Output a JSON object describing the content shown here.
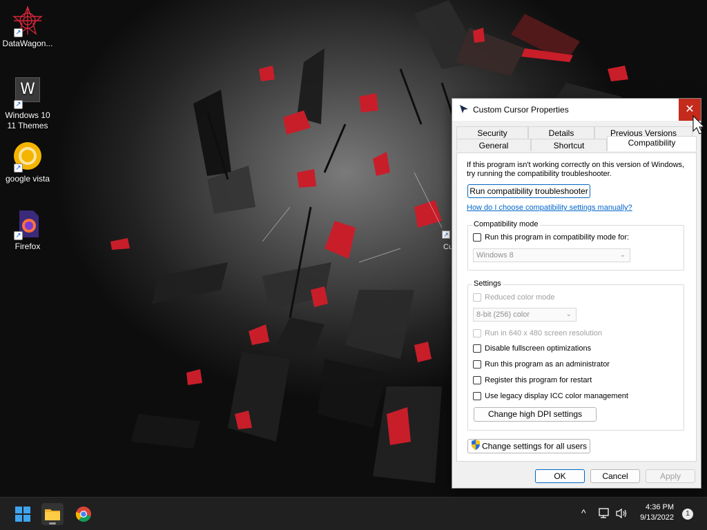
{
  "desktop": {
    "icons": [
      {
        "label": "DataWagon..."
      },
      {
        "label": "Windows 10 11 Themes",
        "glyph_letter": "W"
      },
      {
        "label": "google vista"
      },
      {
        "label": "Firefox"
      }
    ],
    "partial_label": "Cu"
  },
  "dialog": {
    "title": "Custom Cursor Properties",
    "close_glyph": "✕",
    "tabs_row1": [
      "Security",
      "Details",
      "Previous Versions"
    ],
    "tabs_row2": [
      "General",
      "Shortcut",
      "Compatibility"
    ],
    "active_tab": "Compatibility",
    "info_text": "If this program isn't working correctly on this version of Windows, try running the compatibility troubleshooter.",
    "troubleshooter_button": "Run compatibility troubleshooter",
    "manual_link": "How do I choose compatibility settings manually?",
    "compat_mode": {
      "label": "Compatibility mode",
      "checkbox": "Run this program in compatibility mode for:",
      "select_value": "Windows 8"
    },
    "settings": {
      "label": "Settings",
      "reduced_color": "Reduced color mode",
      "color_select": "8-bit (256) color",
      "res640": "Run in 640 x 480 screen resolution",
      "disable_fullscreen": "Disable fullscreen optimizations",
      "run_as_admin": "Run this program as an administrator",
      "register_restart": "Register this program for restart",
      "legacy_icc": "Use legacy display ICC color management",
      "dpi_button": "Change high DPI settings"
    },
    "all_users_button": "Change settings for all users",
    "ok": "OK",
    "cancel": "Cancel",
    "apply": "Apply"
  },
  "taskbar": {
    "time": "4:36 PM",
    "date": "9/13/2022",
    "notification_count": "1",
    "chevron": "^"
  },
  "colors": {
    "close_red": "#c42b1c",
    "accent_blue": "#0067c0",
    "taskbar_bg": "#202020"
  }
}
